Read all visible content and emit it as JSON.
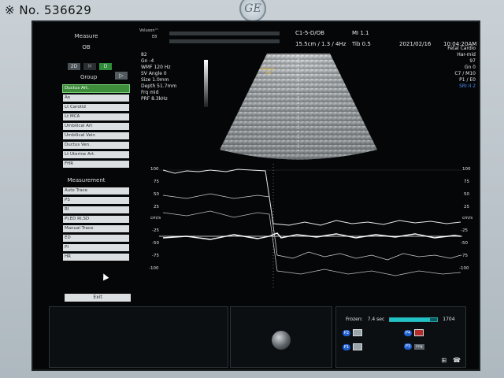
{
  "frame": {
    "serial": "※ No. 536629",
    "brand_logo": "GE"
  },
  "left_panel": {
    "title": "Measure",
    "subtitle": "OB",
    "modes": [
      "2D",
      "M",
      "D"
    ],
    "active_mode": "D",
    "group_label": "Group",
    "group_arrow": "▷",
    "group_items": [
      "Ductus Art.",
      "Ao",
      "Lt Carotid",
      "Lt MCA",
      "Umbilical Art",
      "Umbilical Vein",
      "Ductus Ven.",
      "Lt Uterine Art.",
      "FHR"
    ],
    "selected_group": "Ductus Art.",
    "measurement_label": "Measurement",
    "measurement_items": [
      "Auto Trace",
      "PS",
      "RI",
      "PI,ED RI,SD",
      "Manual Trace",
      "ED",
      "PI",
      "HR"
    ],
    "exit_label": "Exit"
  },
  "header": {
    "brand_small": "Voluson™",
    "brand_model": "E8",
    "probe": "C1-5-D/OB",
    "mi": "MI  1.1",
    "date": "2021/02/16",
    "time": "10:04:20AM",
    "depth_info": "15.5cm / 1.3 / 4Hz",
    "tib": "Tib  0.5"
  },
  "params_left": [
    "82",
    "Gn  -4",
    "WMF 120 Hz",
    "SV Angle  0",
    "Size  1.0mm",
    "Depth 51.7mm",
    "Frq mid",
    "PRF  8.3kHz"
  ],
  "params_right": [
    "Fetal Cardio",
    "Har-mid",
    "97",
    "Gn  0",
    "C7 / M10",
    "P1 / E0",
    "SRI II 2"
  ],
  "sector_label": [
    "Voluson",
    "E8"
  ],
  "doppler": {
    "unit": "cm/s",
    "ticks": [
      "100",
      "75",
      "50",
      "25",
      "-25",
      "-50",
      "-75",
      "-100"
    ]
  },
  "freeze": {
    "label": "Frozen:",
    "time": "7.4 sec",
    "frames": "1704",
    "progress": 0.85
  },
  "presets": [
    {
      "badge": "P2",
      "icon": "printer-icon"
    },
    {
      "badge": "P4",
      "icon": "record-icon"
    },
    {
      "badge": "P1",
      "icon": "printer-icon"
    },
    {
      "badge": "P3",
      "icon": "image-icon",
      "text": "img"
    }
  ],
  "colors": {
    "accent_green": "#3d8d3a",
    "sri_blue": "#4b8df0",
    "label_yellow": "#f2c23a",
    "cine_teal": "#1fc2c5"
  }
}
